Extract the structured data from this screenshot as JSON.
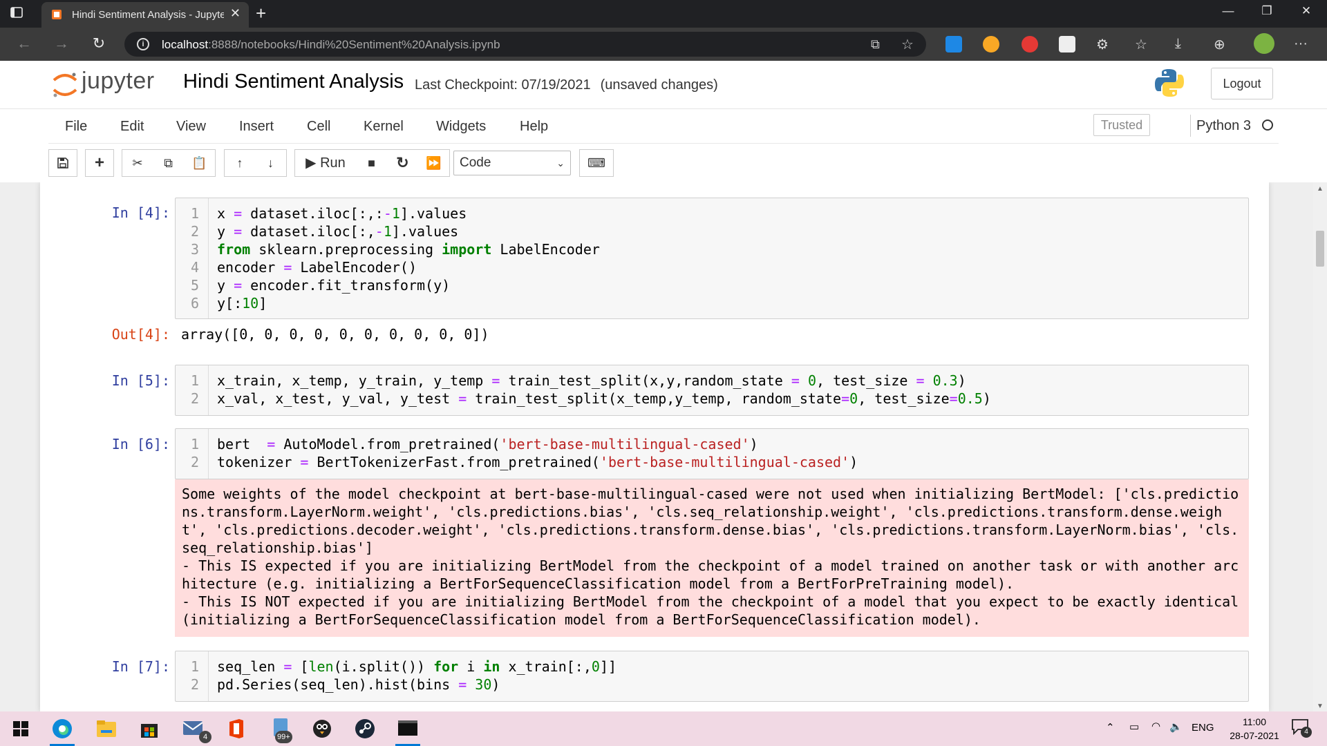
{
  "browser": {
    "tab_title": "Hindi Sentiment Analysis - Jupyter",
    "url_host": "localhost",
    "url_rest": ":8888/notebooks/Hindi%20Sentiment%20Analysis.ipynb"
  },
  "jupyter": {
    "logo_text": "jupyter",
    "notebook_name": "Hindi Sentiment Analysis",
    "checkpoint": "Last Checkpoint: 07/19/2021",
    "status": "(unsaved changes)",
    "logout_label": "Logout",
    "trusted_label": "Trusted",
    "kernel_name": "Python 3"
  },
  "menu": {
    "items": [
      "File",
      "Edit",
      "View",
      "Insert",
      "Cell",
      "Kernel",
      "Widgets",
      "Help"
    ]
  },
  "toolbar": {
    "run_label": "Run",
    "cell_type": "Code"
  },
  "cells": {
    "c4": {
      "in_prompt": "In [4]:",
      "out_prompt": "Out[4]:",
      "output": "array([0, 0, 0, 0, 0, 0, 0, 0, 0, 0])"
    },
    "c5": {
      "in_prompt": "In [5]:"
    },
    "c6": {
      "in_prompt": "In [6]:",
      "stderr": "Some weights of the model checkpoint at bert-base-multilingual-cased were not used when initializing BertModel: ['cls.predictions.transform.LayerNorm.weight', 'cls.predictions.bias', 'cls.seq_relationship.weight', 'cls.predictions.transform.dense.weight', 'cls.predictions.decoder.weight', 'cls.predictions.transform.dense.bias', 'cls.predictions.transform.LayerNorm.bias', 'cls.seq_relationship.bias']\n- This IS expected if you are initializing BertModel from the checkpoint of a model trained on another task or with another architecture (e.g. initializing a BertForSequenceClassification model from a BertForPreTraining model).\n- This IS NOT expected if you are initializing BertModel from the checkpoint of a model that you expect to be exactly identical (initializing a BertForSequenceClassification model from a BertForSequenceClassification model)."
    },
    "c7": {
      "in_prompt": "In [7]:"
    }
  },
  "taskbar": {
    "mail_badge": "4",
    "files_badge": "99+",
    "lang": "ENG",
    "time": "11:00",
    "date": "28-07-2021",
    "notif_badge": "4"
  },
  "colors": {
    "in_prompt": "#303f9f",
    "out_prompt": "#d84315",
    "stderr_bg": "#ffdddd",
    "jupyter_orange": "#f37726"
  }
}
